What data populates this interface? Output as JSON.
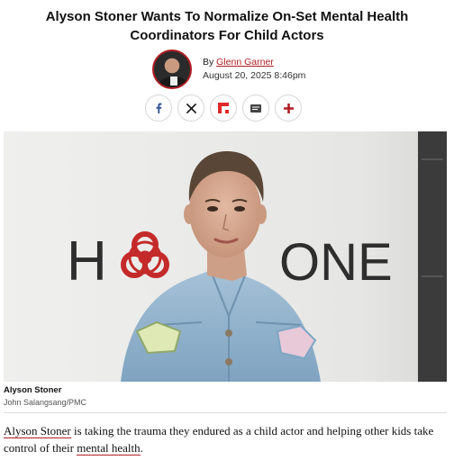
{
  "article": {
    "headline": "Alyson Stoner Wants To Normalize On-Set Mental Health Coordinators For Child Actors",
    "byline_prefix": "By ",
    "author": "Glenn Garner",
    "date": "August 20, 2025 8:46pm"
  },
  "share": {
    "items": [
      {
        "icon": "facebook-icon",
        "color": "#3b5998"
      },
      {
        "icon": "x-icon",
        "color": "#111111"
      },
      {
        "icon": "flipboard-icon",
        "color": "#e12828"
      },
      {
        "icon": "email-icon",
        "color": "#333333"
      },
      {
        "icon": "plus-icon",
        "color": "#b01e23"
      }
    ]
  },
  "hero": {
    "backdrop_left": "H",
    "backdrop_right": "ONE",
    "caption_title": "Alyson Stoner",
    "caption_credit": "John Salangsang/PMC"
  },
  "body": {
    "link1": "Alyson Stoner",
    "text1": " is taking the trauma they endured as a child actor and helping other kids take control of their ",
    "link2": "mental health",
    "text2": "."
  },
  "colors": {
    "accent": "#b01e23",
    "biohazard": "#c42a2a",
    "denim": "#8fb3cf"
  }
}
